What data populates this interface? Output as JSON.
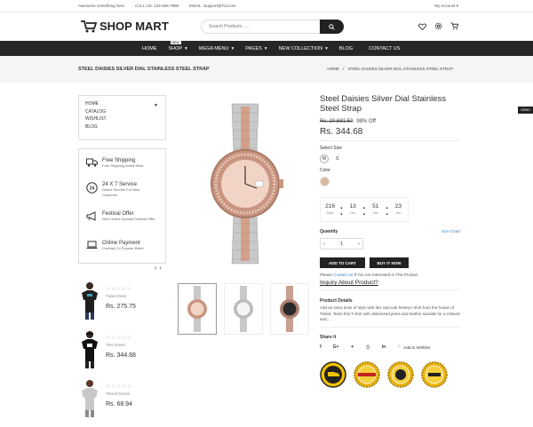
{
  "topbar": {
    "welcome": "Awesome something here",
    "call": "CALL US: 123-456-7890",
    "email": "EMAIL: Support@Fid.com",
    "account": "My Account"
  },
  "header": {
    "logo": "SHOP MART",
    "search_placeholder": "Search Products......"
  },
  "nav": {
    "items": [
      "HOME",
      "SHOP",
      "MEGA MENU",
      "PAGES",
      "NEW COLLECTION",
      "BLOG",
      "CONTACT US"
    ],
    "badge": "NEW"
  },
  "breadcrumb": {
    "title": "STEEL DAISIES SILVER DIAL STAINLESS STEEL STRAP",
    "home": "HOME",
    "sep": "/",
    "current": "STEEL DAISIES SILVER DIAL STAINLESS STEEL STRAP"
  },
  "sidebar": {
    "menu": [
      "HOME",
      "CATALOG",
      "WISHLIST",
      "BLOG"
    ]
  },
  "services": [
    {
      "title": "Free Shipping",
      "sub": "Free Shipping World Wide",
      "icon": "truck-icon"
    },
    {
      "title": "24 X 7 Service",
      "sub": "Online Service For New Customer",
      "icon": "clock-24-icon"
    },
    {
      "title": "Festival Offer",
      "sub": "New Online Special Festival Offer",
      "icon": "megaphone-icon"
    },
    {
      "title": "Online Payment",
      "sub": "Contrary To Popular Belief",
      "icon": "laptop-icon"
    }
  ],
  "products": [
    {
      "name": "Tube Dress",
      "price": "Rs. 275.75"
    },
    {
      "name": "Trim Dress",
      "price": "Rs. 344.68"
    },
    {
      "name": "Trench Dress",
      "price": "Rs. 68.94"
    }
  ],
  "product": {
    "title": "Steel Daisies Silver Dial Stainless Steel Strap",
    "old_price": "Rs. 20,681.50",
    "discount": "98% Off",
    "price": "Rs. 344.68",
    "size_label": "Select Size",
    "sizes": [
      "M",
      "S"
    ],
    "color_label": "Color",
    "countdown": [
      {
        "v": "216",
        "u": "Days"
      },
      {
        "v": "13",
        "u": "Hrs"
      },
      {
        "v": "51",
        "u": "Min"
      },
      {
        "v": "23",
        "u": "Sec"
      }
    ],
    "quantity_label": "Quantity",
    "size_chart": "Size Chart",
    "quantity": "1",
    "add_to_cart": "ADD TO CART",
    "buy_now": "BUY IT NOW",
    "note_prefix": "Please",
    "note_link": "Contact Us",
    "note_suffix": "If You Are Interested In This Product",
    "inquiry": "Inquiry About Product?",
    "details_label": "Product Details",
    "details_text": "Add an extra dose of style with this raw look henley t-shirt from the house of Tinted. Team this T-shirt with distressed jeans and leather sandals for a relaxed and...",
    "share_label": "Share It",
    "wishlist": "Add to Wishlist"
  },
  "badges": [
    "FREE SHIPPING",
    "FREE SHIPPING",
    "MONEY BACK",
    "GUARANTEE"
  ],
  "sidetab": "DEMO",
  "colors": {
    "dark": "#262626",
    "accent": "#3b82c4",
    "gold": "#e8b10e"
  }
}
